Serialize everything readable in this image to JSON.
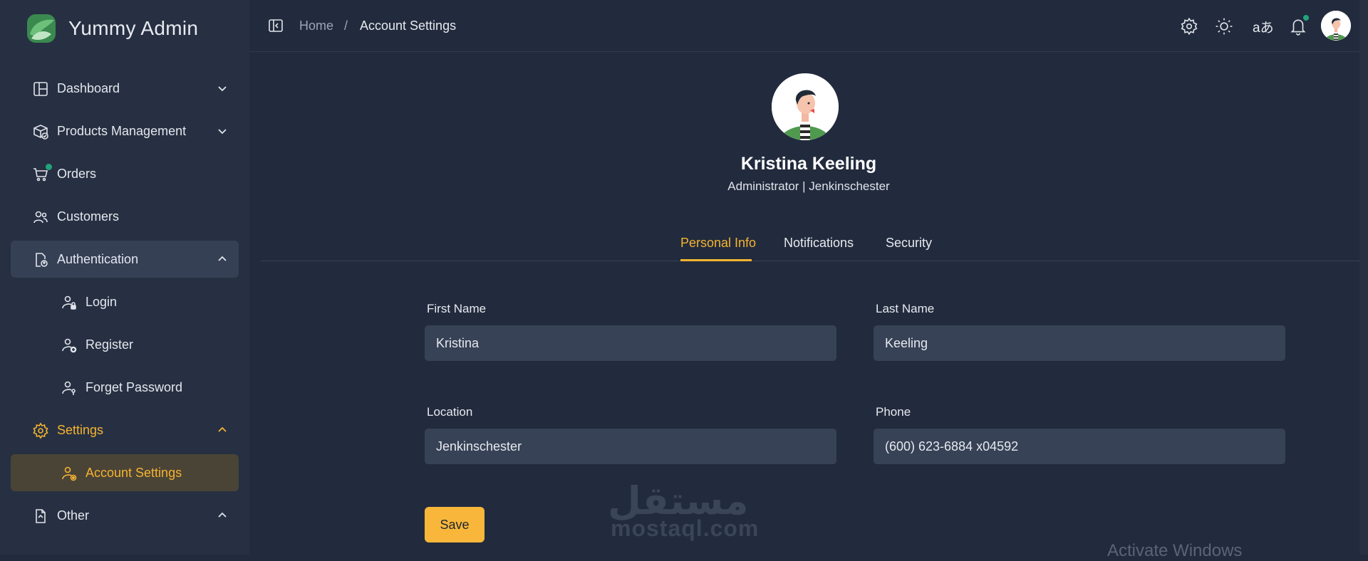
{
  "brand": {
    "name": "Yummy Admin",
    "logo_icon": "yummy-logo-icon"
  },
  "sidebar": {
    "items": [
      {
        "label": "Dashboard",
        "icon": "layout-icon",
        "chevron": "down"
      },
      {
        "label": "Products Management",
        "icon": "box-icon",
        "chevron": "down"
      },
      {
        "label": "Orders",
        "icon": "cart-icon",
        "badge_dot": true
      },
      {
        "label": "Customers",
        "icon": "users-icon"
      },
      {
        "label": "Authentication",
        "icon": "auth-icon",
        "chevron": "up",
        "expanded": true
      },
      {
        "label": "Login",
        "icon": "user-lock-icon"
      },
      {
        "label": "Register",
        "icon": "user-plus-icon"
      },
      {
        "label": "Forget Password",
        "icon": "user-key-icon"
      },
      {
        "label": "Settings",
        "icon": "gear-icon",
        "chevron": "up",
        "expanded": true
      },
      {
        "label": "Account Settings",
        "icon": "user-gear-icon",
        "active": true
      },
      {
        "label": "Other",
        "icon": "file-icon",
        "chevron": "up"
      }
    ]
  },
  "header": {
    "breadcrumb": {
      "home": "Home",
      "separator": "/",
      "current": "Account Settings"
    },
    "language_label": "aあ",
    "icons": [
      "sidebar-toggle-icon",
      "settings-icon",
      "sun-icon",
      "translate-icon",
      "bell-icon",
      "avatar"
    ]
  },
  "profile": {
    "name": "Kristina Keeling",
    "subtitle": "Administrator | Jenkinschester"
  },
  "tabs": [
    {
      "label": "Personal Info",
      "active": true
    },
    {
      "label": "Notifications",
      "active": false
    },
    {
      "label": "Security",
      "active": false
    }
  ],
  "form": {
    "first_name": {
      "label": "First Name",
      "value": "Kristina"
    },
    "last_name": {
      "label": "Last Name",
      "value": "Keeling"
    },
    "location": {
      "label": "Location",
      "value": "Jenkinschester"
    },
    "phone": {
      "label": "Phone",
      "value": "(600) 623-6884 x04592"
    },
    "save_label": "Save"
  },
  "watermark": {
    "arabic": "مستقل",
    "latin": "mostaql.com",
    "os_notice": "Activate Windows"
  },
  "colors": {
    "accent": "#f5b331",
    "background": "#222b3d",
    "sidebar": "#273042",
    "input": "#374256",
    "status_dot": "#22a37a"
  }
}
